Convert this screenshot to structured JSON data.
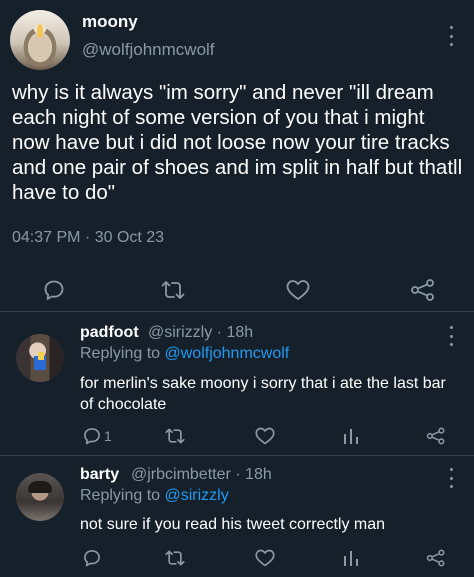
{
  "main_tweet": {
    "display_name": "moony",
    "handle": "@wolfjohnmcwolf",
    "text": "why is it always \"im sorry\" and never \"ill dream each night of some version of you that i might now have but i did not loose now your tire tracks and one pair of shoes and im split in half but thatll have to do\"",
    "timestamp": "04:37 PM · 30 Oct 23",
    "actions": [
      "reply-icon",
      "retweet-icon",
      "like-icon",
      "share-icon"
    ]
  },
  "replies": [
    {
      "display_name": "padfoot",
      "meta": "@sirizzly · 18h",
      "replying_prefix": "Replying to ",
      "replying_to": "@wolfjohnmcwolf",
      "text": "for merlin's sake moony i sorry that i ate the last bar of chocolate",
      "reply_count": "1"
    },
    {
      "display_name": "barty",
      "meta": "@jrbcimbetter · 18h",
      "replying_prefix": "Replying to ",
      "replying_to": "@sirizzly",
      "text": "not sure if you read his tweet correctly man",
      "reply_count": ""
    }
  ],
  "colors": {
    "background": "#15202b",
    "secondary_text": "#8b98a5",
    "link": "#1d9bf0",
    "divider": "#38444d"
  }
}
